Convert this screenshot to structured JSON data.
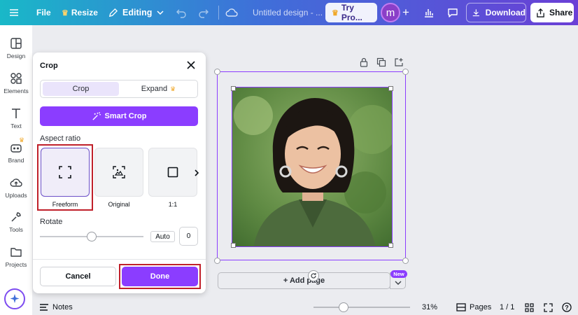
{
  "topbar": {
    "file": "File",
    "resize": "Resize",
    "editing": "Editing",
    "doc_title": "Untitled design - ...",
    "try_pro": "Try Pro...",
    "avatar_letter": "m",
    "download": "Download",
    "share": "Share"
  },
  "sidebar": {
    "items": [
      {
        "label": "Design",
        "icon": "design-icon"
      },
      {
        "label": "Elements",
        "icon": "elements-icon"
      },
      {
        "label": "Text",
        "icon": "text-icon"
      },
      {
        "label": "Brand",
        "icon": "brand-icon"
      },
      {
        "label": "Uploads",
        "icon": "uploads-icon"
      },
      {
        "label": "Tools",
        "icon": "tools-icon"
      },
      {
        "label": "Projects",
        "icon": "projects-icon"
      }
    ]
  },
  "crop_panel": {
    "title": "Crop",
    "tab_crop": "Crop",
    "tab_expand": "Expand",
    "smart_crop": "Smart Crop",
    "aspect_label": "Aspect ratio",
    "ratios": [
      {
        "label": "Freeform",
        "icon": "freeform-icon",
        "selected": true
      },
      {
        "label": "Original",
        "icon": "original-icon",
        "selected": false
      },
      {
        "label": "1:1",
        "icon": "square-icon",
        "selected": false
      }
    ],
    "rotate_label": "Rotate",
    "rotate_auto": "Auto",
    "rotate_value": "0",
    "rotate_level": 0.5,
    "cancel": "Cancel",
    "done": "Done"
  },
  "canvas": {
    "add_page": "+ Add page",
    "new_badge": "New"
  },
  "bottombar": {
    "notes": "Notes",
    "zoom": "31%",
    "zoom_level": 0.31,
    "pages": "Pages",
    "page_count": "1 / 1"
  },
  "colors": {
    "accent": "#8b3dff",
    "highlight": "#c0202a"
  }
}
